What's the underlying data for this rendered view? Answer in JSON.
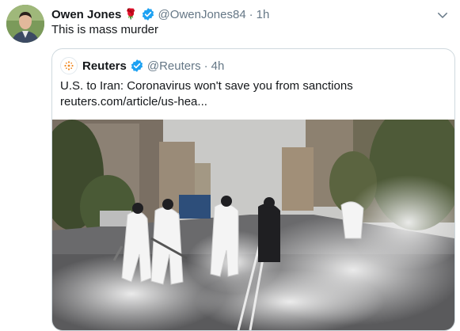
{
  "tweet": {
    "author_name": "Owen Jones",
    "emoji": "🌹",
    "handle": "@OwenJones84",
    "separator": "·",
    "time": "1h",
    "text": "This is mass murder"
  },
  "quote": {
    "author_name": "Reuters",
    "handle": "@Reuters",
    "separator": "·",
    "time": "4h",
    "headline": "U.S. to Iran: Coronavirus won't save you from sanctions",
    "link": "reuters.com/article/us-hea..."
  },
  "icons": [
    "avatar",
    "rose-emoji",
    "verified-badge-icon",
    "chevron-down-icon",
    "reuters-logo-icon"
  ],
  "colors": {
    "text_primary": "#14171a",
    "text_secondary": "#657786",
    "verified_blue": "#1da1f2",
    "border": "#cfd9de",
    "reuters_orange": "#f08a24"
  }
}
